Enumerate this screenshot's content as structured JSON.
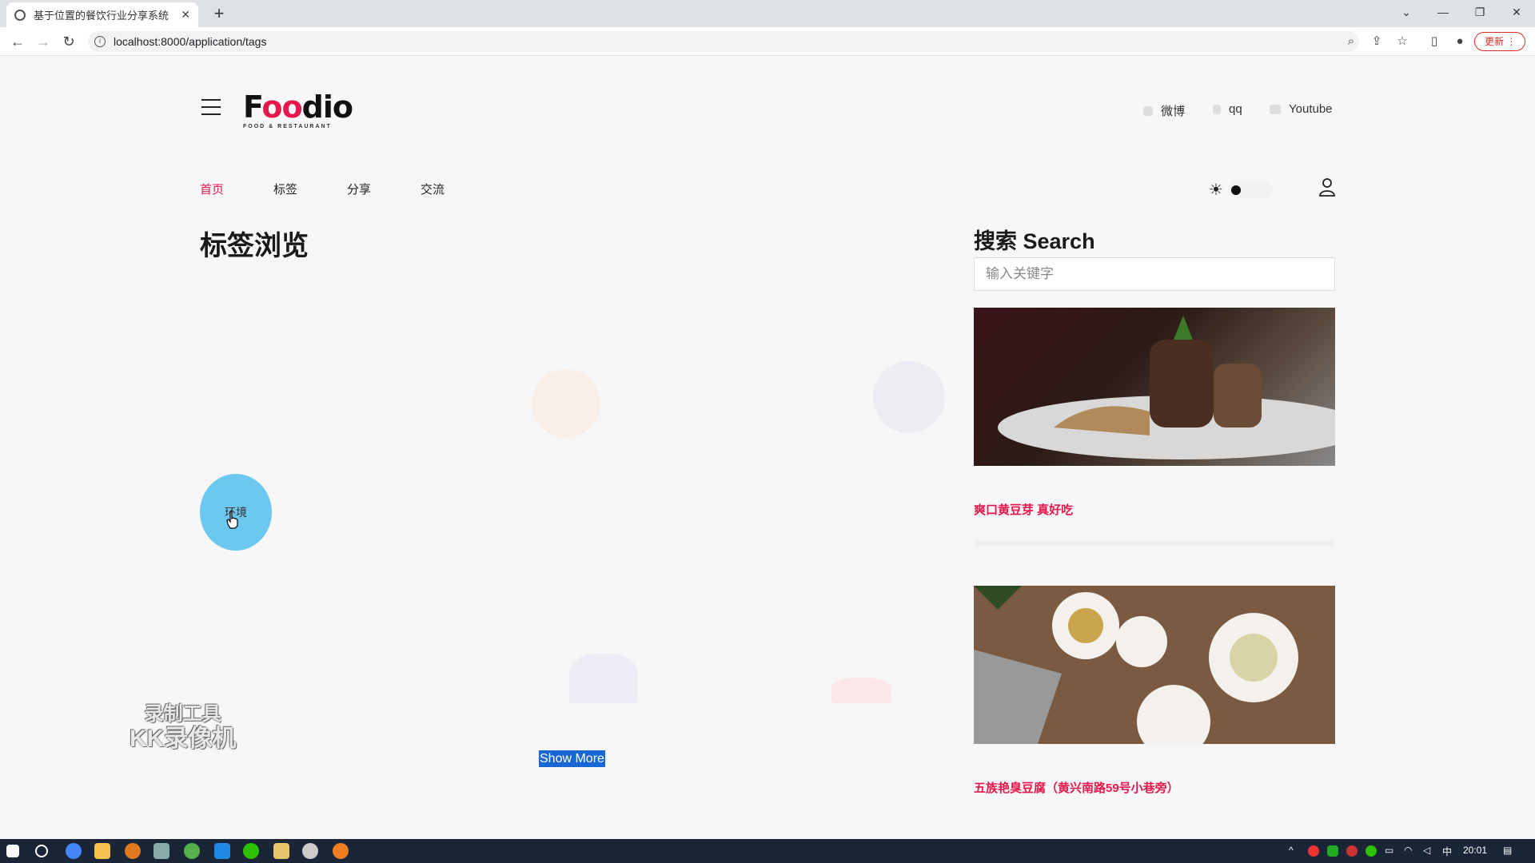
{
  "browser": {
    "tab_title": "基于位置的餐饮行业分享系统",
    "url": "localhost:8000/application/tags",
    "update_label": "更新"
  },
  "site": {
    "logo_text_pre": "F",
    "logo_text_oo": "oo",
    "logo_text_post": "dio",
    "logo_tagline": "FOOD & RESTAURANT",
    "social": [
      {
        "label": "微博",
        "icon": "weibo-icon"
      },
      {
        "label": "qq",
        "icon": "qq-icon"
      },
      {
        "label": "Youtube",
        "icon": "youtube-icon"
      }
    ],
    "nav": [
      {
        "label": "首页",
        "active": true
      },
      {
        "label": "标签",
        "active": false
      },
      {
        "label": "分享",
        "active": false
      },
      {
        "label": "交流",
        "active": false
      }
    ],
    "accent_color": "#e6174b"
  },
  "main": {
    "title": "标签浏览",
    "active_tag_label": "环境",
    "show_more_label": "Show More"
  },
  "sidebar": {
    "search_title": "搜索 Search",
    "search_placeholder": "输入关键字",
    "posts": [
      {
        "title": "爽口黄豆芽 真好吃"
      },
      {
        "title": "五族艳臭豆腐（黄兴南路59号小巷旁）"
      }
    ]
  },
  "watermark": {
    "line1": "录制工具",
    "line2": "KK录像机"
  },
  "taskbar": {
    "ime": "中",
    "time": "20:01"
  }
}
